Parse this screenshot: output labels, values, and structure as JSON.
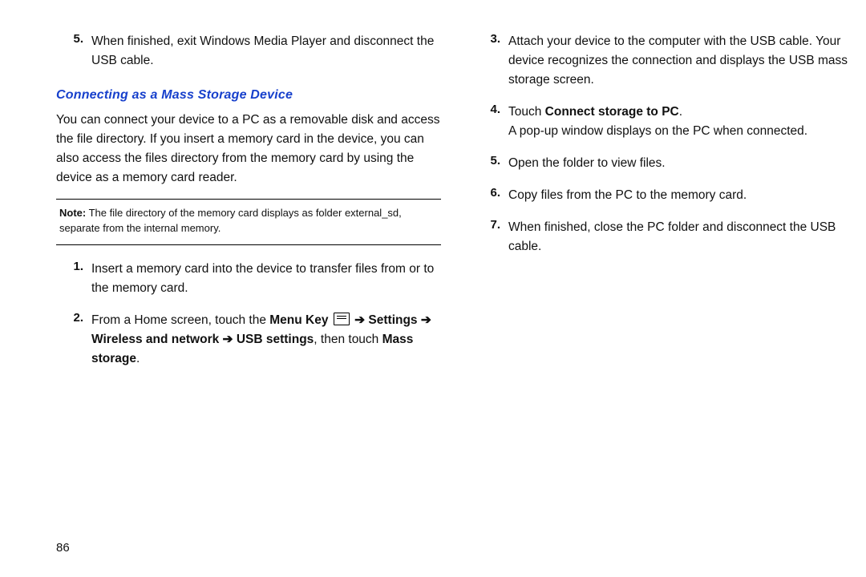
{
  "left": {
    "step5": {
      "num": "5.",
      "text": "When finished, exit Windows Media Player and disconnect the USB cable."
    },
    "heading": "Connecting as a Mass Storage Device",
    "intro": "You can connect your device to a PC as a removable disk and access the file directory. If you insert a memory card in the device, you can also access the files directory from the memory card by using the device as a memory card reader.",
    "note_label": "Note:",
    "note_body": " The file directory of the memory card displays as folder external_sd, separate from the internal memory.",
    "step1": {
      "num": "1.",
      "text": "Insert a memory card into the device to transfer files from or to the memory card."
    },
    "step2": {
      "num": "2.",
      "prefix": "From a Home screen, touch the ",
      "menu_key": "Menu Key",
      "arrow1": " ➔ ",
      "settings": "Settings",
      "arrow2": " ➔ ",
      "wireless": "Wireless and network",
      "arrow3": " ➔ ",
      "usb": "USB settings",
      "then": ", then touch ",
      "mass": "Mass storage",
      "period": "."
    }
  },
  "right": {
    "step3": {
      "num": "3.",
      "text": "Attach your device to the computer with the USB cable. Your device recognizes the connection and displays the USB mass storage screen."
    },
    "step4": {
      "num": "4.",
      "touch": "Touch ",
      "bold": "Connect storage to PC",
      "after": ".",
      "line2": "A pop-up window displays on the PC when connected."
    },
    "step5": {
      "num": "5.",
      "text": "Open the folder to view files."
    },
    "step6": {
      "num": "6.",
      "text": "Copy files from the PC to the memory card."
    },
    "step7": {
      "num": "7.",
      "text": "When finished, close the PC folder and disconnect the USB cable."
    }
  },
  "page_number": "86"
}
